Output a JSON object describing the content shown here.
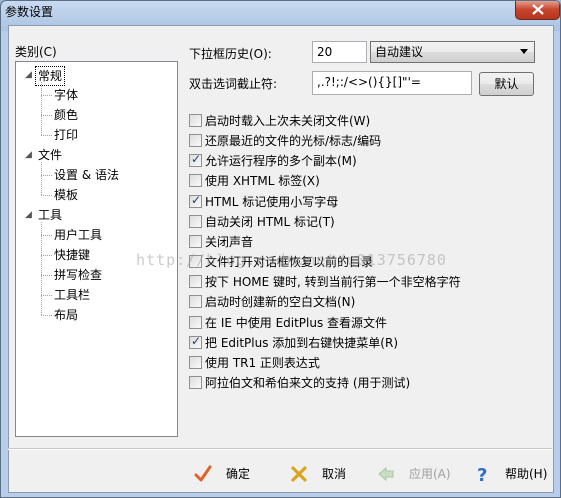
{
  "window": {
    "title": "参数设置",
    "close_icon": "close-x-icon"
  },
  "category": {
    "label": "类别(C)",
    "items": [
      {
        "label": "常规",
        "level": 0,
        "expanded": true,
        "selected": true
      },
      {
        "label": "字体",
        "level": 1
      },
      {
        "label": "颜色",
        "level": 1
      },
      {
        "label": "打印",
        "level": 1
      },
      {
        "label": "文件",
        "level": 0,
        "expanded": true
      },
      {
        "label": "设置 & 语法",
        "level": 1
      },
      {
        "label": "模板",
        "level": 1
      },
      {
        "label": "工具",
        "level": 0,
        "expanded": true
      },
      {
        "label": "用户工具",
        "level": 1
      },
      {
        "label": "快捷键",
        "level": 1
      },
      {
        "label": "拼写检查",
        "level": 1
      },
      {
        "label": "工具栏",
        "level": 1
      },
      {
        "label": "布局",
        "level": 1
      }
    ]
  },
  "dropdown_history": {
    "label": "下拉框历史(O):",
    "value": "20",
    "mode": "自动建议"
  },
  "delimiters": {
    "label": "双击选词截止符:",
    "value": ",.?!;:/<>(){}[]\"'=",
    "default_button": "默认"
  },
  "options": [
    {
      "label": "启动时载入上次未关闭文件(W)",
      "checked": false
    },
    {
      "label": "还原最近的文件的光标/标志/编码",
      "checked": false
    },
    {
      "label": "允许运行程序的多个副本(M)",
      "checked": true
    },
    {
      "label": "使用 XHTML 标签(X)",
      "checked": false
    },
    {
      "label": "HTML 标记使用小写字母",
      "checked": true
    },
    {
      "label": "自动关闭 HTML 标记(T)",
      "checked": false
    },
    {
      "label": "关闭声音",
      "checked": false
    },
    {
      "label": "文件打开对话框恢复以前的目录",
      "checked": false
    },
    {
      "label": "按下 HOME 键时, 转到当前行第一个非空格字符",
      "checked": false
    },
    {
      "label": "启动时创建新的空白文档(N)",
      "checked": false
    },
    {
      "label": "在 IE 中使用 EditPlus 查看源文件",
      "checked": false
    },
    {
      "label": "把 EditPlus 添加到右键快捷菜单(R)",
      "checked": true
    },
    {
      "label": "使用 TR1 正则表达式",
      "checked": false
    },
    {
      "label": "阿拉伯文和希伯来文的支持 (用于测试)",
      "checked": false
    }
  ],
  "footer": {
    "ok": "确定",
    "cancel": "取消",
    "apply": "应用(A)",
    "help": "帮助(H)",
    "ok_icon": "checkmark-icon",
    "cancel_icon": "x-cross-icon",
    "apply_icon": "left-arrow-icon",
    "help_icon": "question-mark-icon",
    "colors": {
      "ok": "#e0622b",
      "cancel": "#d9a520",
      "apply": "#a8c8a0",
      "help": "#2f6fc9"
    }
  },
  "watermark": "http://blog.csdn.net/u013756780"
}
